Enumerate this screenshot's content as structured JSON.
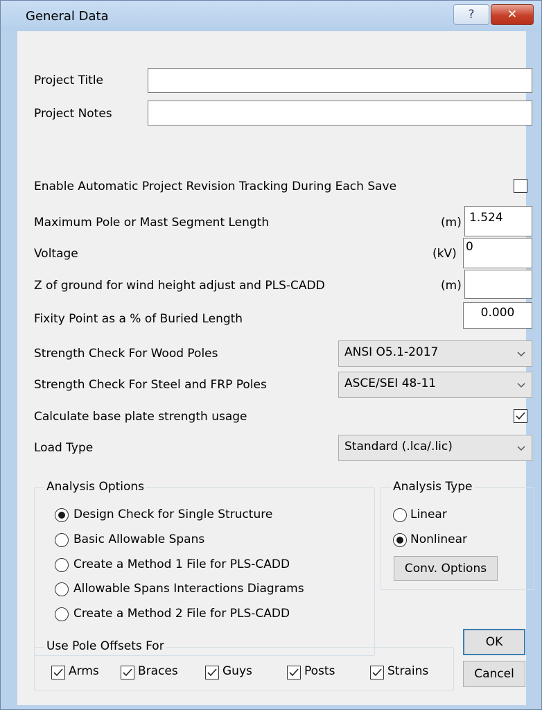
{
  "window": {
    "title": "General Data",
    "help_label": "?",
    "close_label": "✕"
  },
  "project": {
    "title_label": "Project Title",
    "title_value": "",
    "notes_label": "Project Notes",
    "notes_value": ""
  },
  "settings": {
    "revision_tracking_label": "Enable Automatic Project Revision Tracking During Each Save",
    "revision_tracking_checked": false,
    "segment_length_label": "Maximum Pole or Mast Segment Length",
    "segment_length_unit": "(m)",
    "segment_length_value": "1.524",
    "voltage_label": "Voltage",
    "voltage_unit": "(kV)",
    "voltage_value": "0",
    "z_ground_label": "Z of ground for wind height adjust and PLS-CADD",
    "z_ground_unit": "(m)",
    "z_ground_value": "",
    "fixity_label": "Fixity Point as a % of Buried Length",
    "fixity_value": "0.000",
    "wood_label": "Strength Check For Wood Poles",
    "wood_value": "ANSI O5.1-2017",
    "steel_label": "Strength Check For Steel and FRP Poles",
    "steel_value": "ASCE/SEI 48-11",
    "base_plate_label": "Calculate base plate strength usage",
    "base_plate_checked": true,
    "load_type_label": "Load Type",
    "load_type_value": "Standard (.lca/.lic)"
  },
  "analysis_options": {
    "legend": "Analysis Options",
    "items": [
      {
        "label": "Design Check for Single Structure",
        "selected": true
      },
      {
        "label": "Basic Allowable Spans",
        "selected": false
      },
      {
        "label": "Create a Method 1 File for PLS-CADD",
        "selected": false
      },
      {
        "label": "Allowable Spans Interactions Diagrams",
        "selected": false
      },
      {
        "label": "Create a Method 2 File for PLS-CADD",
        "selected": false
      }
    ]
  },
  "analysis_type": {
    "legend": "Analysis Type",
    "items": [
      {
        "label": "Linear",
        "selected": false
      },
      {
        "label": "Nonlinear",
        "selected": true
      }
    ],
    "conv_button": "Conv. Options"
  },
  "pole_offsets": {
    "legend": "Use Pole Offsets For",
    "items": [
      {
        "label": "Arms",
        "checked": true
      },
      {
        "label": "Braces",
        "checked": true
      },
      {
        "label": "Guys",
        "checked": true
      },
      {
        "label": "Posts",
        "checked": true
      },
      {
        "label": "Strains",
        "checked": true
      }
    ]
  },
  "buttons": {
    "ok": "OK",
    "cancel": "Cancel"
  },
  "colors": {
    "frame": "#b9d1ea",
    "client": "#f0f0f0",
    "close": "#c7412a",
    "default_button_border": "#3c7fb1"
  }
}
